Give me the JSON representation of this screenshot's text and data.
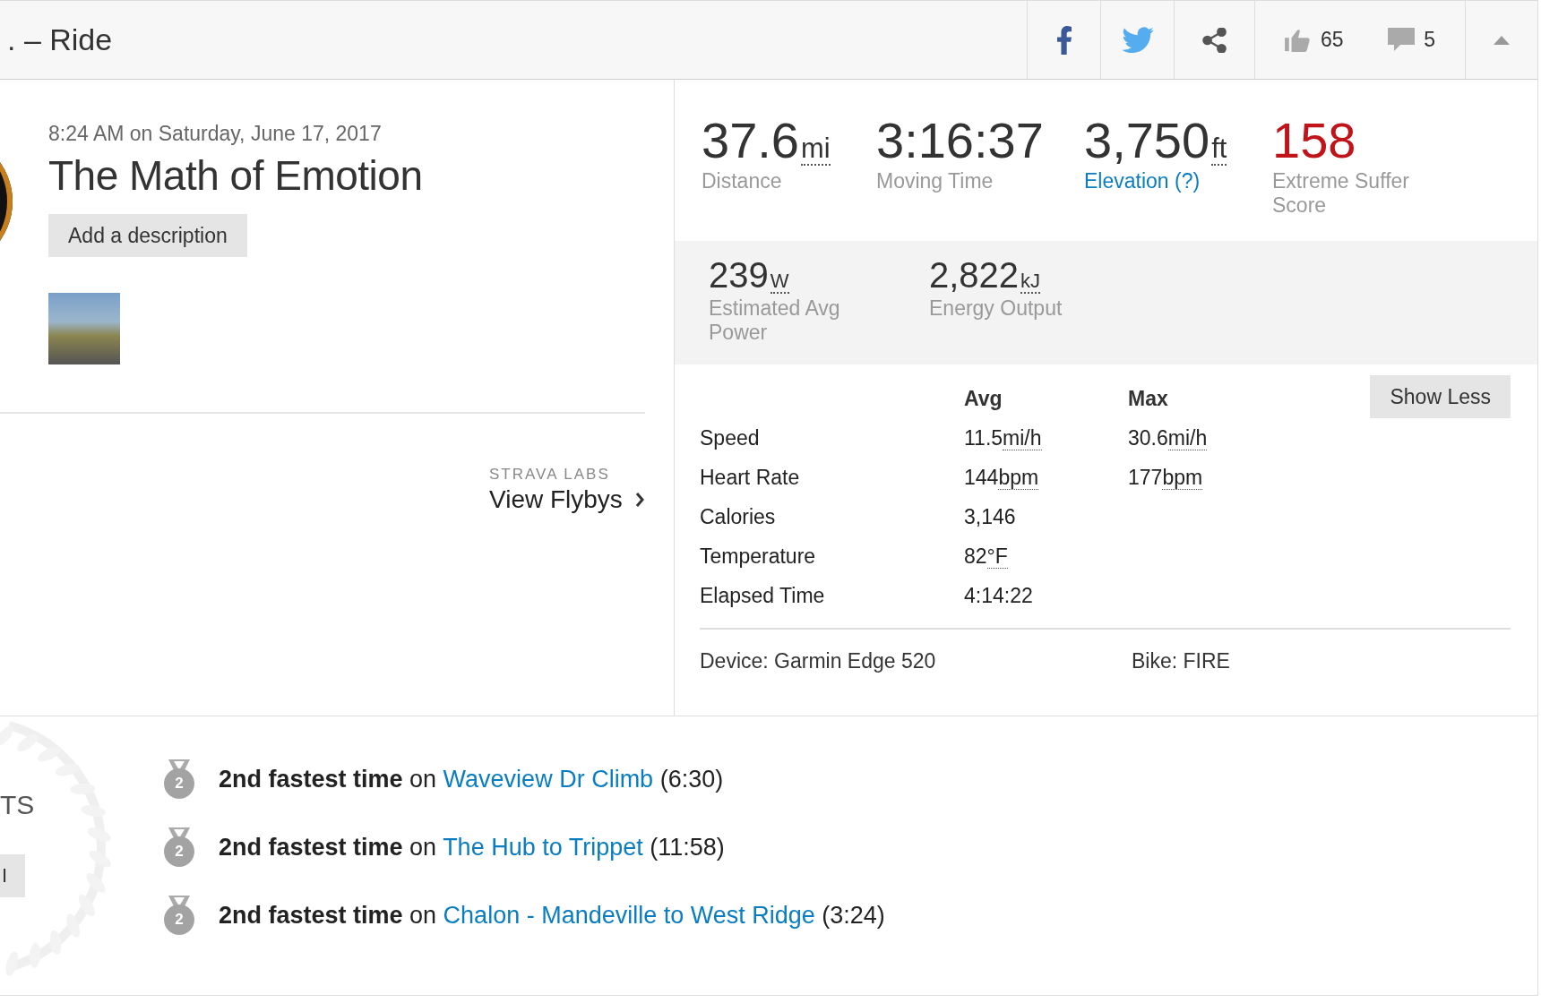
{
  "header": {
    "title": ". – Ride",
    "share_buttons": [
      {
        "kind": "facebook"
      },
      {
        "kind": "twitter"
      },
      {
        "kind": "share"
      }
    ],
    "kudos_count": "65",
    "comment_count": "5"
  },
  "activity": {
    "date": "8:24 AM on Saturday, June 17, 2017",
    "title": "The Math of Emotion",
    "add_description_button": "Add a description"
  },
  "flybys": {
    "label": "STRAVA LABS",
    "link": "View Flybys"
  },
  "stats": [
    {
      "value": "37.6",
      "unit": "mi",
      "label": "Distance",
      "kind": "plain"
    },
    {
      "value": "3:16:37",
      "label": "Moving Time",
      "kind": "plain"
    },
    {
      "value": "3,750",
      "unit": "ft",
      "label": "Elevation (?)",
      "kind": "link"
    },
    {
      "value": "158",
      "label": "Extreme Suffer Score",
      "kind": "score"
    }
  ],
  "secondary_stats": [
    {
      "value": "239",
      "unit": "W",
      "label": "Estimated Avg Power"
    },
    {
      "value": "2,822",
      "unit": "kJ",
      "label": "Energy Output"
    }
  ],
  "details": {
    "columns": [
      "Avg",
      "Max"
    ],
    "show_less_button": "Show Less",
    "rows": [
      {
        "label": "Speed",
        "avg": {
          "value": "11.5",
          "unit": "mi/h"
        },
        "max": {
          "value": "30.6",
          "unit": "mi/h"
        }
      },
      {
        "label": "Heart Rate",
        "avg": {
          "value": "144",
          "unit": "bpm"
        },
        "max": {
          "value": "177",
          "unit": "bpm"
        }
      },
      {
        "label": "Calories",
        "avg": {
          "value": "3,146"
        }
      },
      {
        "label": "Temperature",
        "avg": {
          "value": "82",
          "unit": "°F"
        }
      },
      {
        "label": "Elapsed Time",
        "avg": {
          "value": "4:14:22"
        }
      }
    ],
    "device": "Device: Garmin Edge 520",
    "bike": "Bike: FIRE"
  },
  "achievements": {
    "heading_fragment": "TS",
    "button_fragment": "I",
    "items": [
      {
        "rank": "2",
        "text": "**2nd fastest time** on",
        "segment": "Waveview Dr Climb",
        "time": "(6:30)"
      },
      {
        "rank": "2",
        "text": "**2nd fastest time** on",
        "segment": "The Hub to Trippet",
        "time": "(11:58)"
      },
      {
        "rank": "2",
        "text": "**2nd fastest time** on",
        "segment": "Chalon - Mandeville to West Ridge",
        "time": "(3:24)"
      }
    ]
  }
}
